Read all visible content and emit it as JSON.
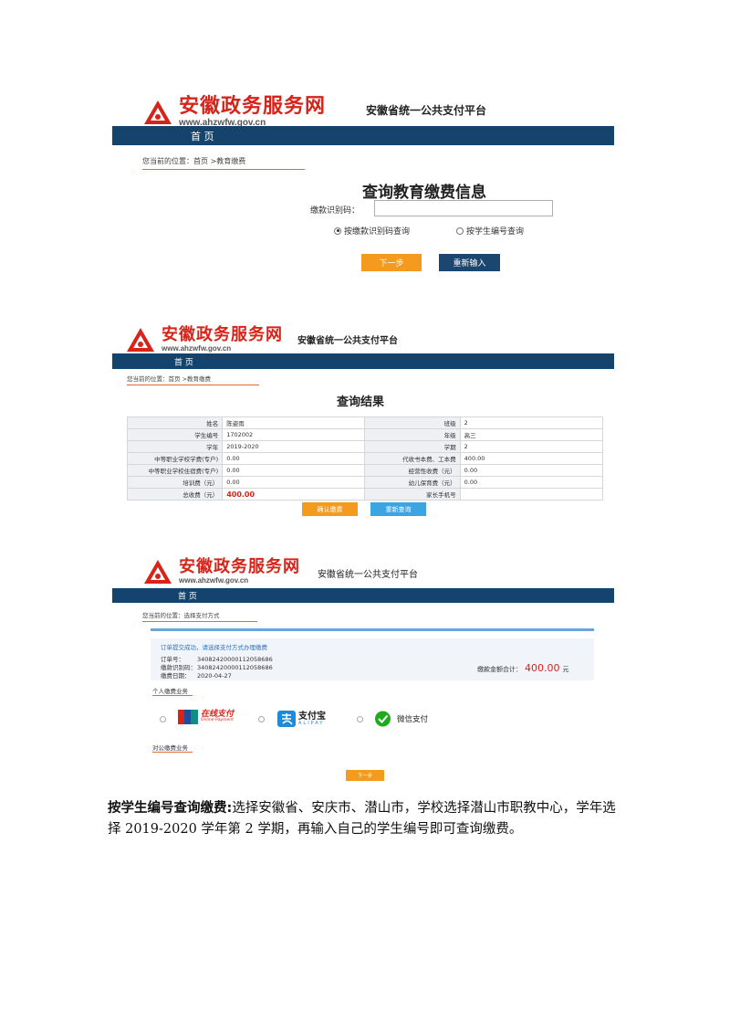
{
  "header": {
    "logo_cn": "安徽政务服务网",
    "logo_url": "www.ahzwfw.gov.cn",
    "platform": "安徽省统一公共支付平台",
    "nav_home": "首 页"
  },
  "colors": {
    "brand_red": "#d7241a",
    "nav_navy": "#14446d",
    "accent_orange": "#f39a1f",
    "link_blue": "#3da4e4"
  },
  "query_screen": {
    "breadcrumb": "您当前的位置：首页 >教育缴费",
    "title": "查询教育缴费信息",
    "code_label": "缴款识别码：",
    "code_value": "",
    "radio_code": "按缴款识别码查询",
    "radio_student": "按学生编号查询",
    "next_button": "下一步",
    "reset_button": "重新输入"
  },
  "result_screen": {
    "breadcrumb": "您当前的位置：首页 >教育缴费",
    "title": "查询结果",
    "rows": [
      {
        "l1": "姓名",
        "v1": "陈姿雨",
        "l2": "班级",
        "v2": "2"
      },
      {
        "l1": "学生编号",
        "v1": "1702002",
        "l2": "年级",
        "v2": "高三"
      },
      {
        "l1": "学年",
        "v1": "2019-2020",
        "l2": "学期",
        "v2": "2"
      },
      {
        "l1": "中等职业学校学费(专户)",
        "v1": "0.00",
        "l2": "代收书本费、工本费",
        "v2": "400.00"
      },
      {
        "l1": "中等职业学校住宿费(专户)",
        "v1": "0.00",
        "l2": "经营性收费（元）",
        "v2": "0.00"
      },
      {
        "l1": "培训费（元）",
        "v1": "0.00",
        "l2": "幼儿保育费（元）",
        "v2": "0.00"
      },
      {
        "l1": "总收费（元）",
        "v1": "400.00",
        "l2": "家长手机号",
        "v2": ""
      }
    ],
    "confirm_button": "确认缴费",
    "requery_button": "重新查询"
  },
  "pay_screen": {
    "breadcrumb": "您当前的位置：选择支付方式",
    "success_msg": "订单提交成功，请选择支付方式办理缴费",
    "order_no_label": "订单号：",
    "order_no": "34082420000112058686",
    "pay_code_label": "缴款识别码：",
    "pay_code": "34082420000112058686",
    "pay_date_label": "缴费日期：",
    "pay_date": "2020-04-27",
    "total_label": "缴款金额合计：",
    "total_amount": "400.00",
    "total_unit": "元",
    "personal_section": "个人缴费业务",
    "corporate_section": "对公缴费业务",
    "unionpay_text": "在线支付",
    "unionpay_sub": "Online Payment",
    "alipay_text": "支付宝",
    "alipay_sub": "ALIPAY",
    "wechat_text": "微信支付",
    "next_button": "下一步"
  },
  "caption": {
    "lead": "按学生编号查询缴费:",
    "body": "选择安徽省、安庆市、潜山市，学校选择潜山市职教中心，学年选择 2019-2020 学年第 2 学期，再输入自己的学生编号即可查询缴费。"
  }
}
